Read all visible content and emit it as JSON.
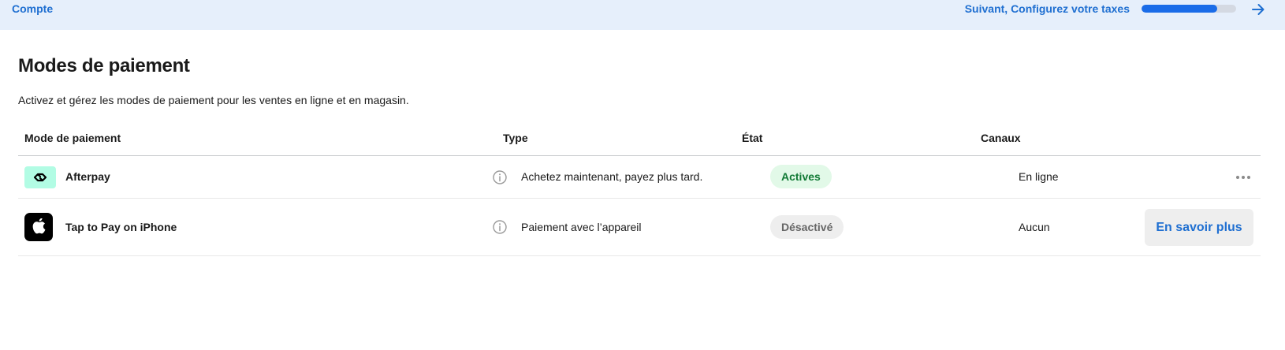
{
  "banner": {
    "left_link": "Compte",
    "next_label": "Suivant, Configurez votre taxes",
    "progress_percent": 80,
    "arrow_icon": "arrow-right-icon"
  },
  "page": {
    "title": "Modes de paiement",
    "description": "Activez et gérez les modes de paiement pour les ventes en ligne et en magasin."
  },
  "table": {
    "headers": {
      "method": "Mode de paiement",
      "type": "Type",
      "state": "État",
      "channels": "Canaux"
    },
    "rows": [
      {
        "logo_icon": "afterpay-logo-icon",
        "name": "Afterpay",
        "type": "Achetez maintenant, payez plus tard.",
        "state": "Actives",
        "state_color": "#117a35",
        "channels": "En ligne",
        "action_icon": "more-options-icon"
      },
      {
        "logo_icon": "apple-logo-icon",
        "name": "Tap to Pay on iPhone",
        "type": "Paiement avec l’appareil",
        "state": "Désactivé",
        "state_color": "#666666",
        "channels": "Aucun",
        "action_label": "En savoir plus"
      }
    ]
  },
  "colors": {
    "accent": "#1f6fd1",
    "banner_bg": "#e6effb"
  }
}
